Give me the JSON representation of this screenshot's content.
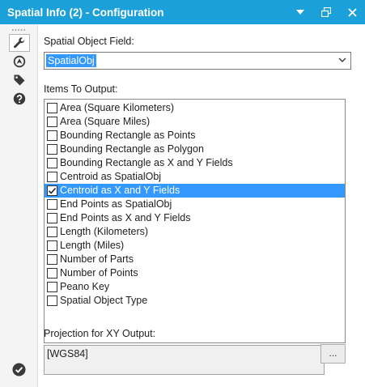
{
  "window": {
    "title": "Spatial Info (2) - Configuration",
    "buttons": [
      "chevron-down-icon",
      "restore-icon",
      "close-icon"
    ]
  },
  "toolbar": {
    "tools": [
      {
        "icon": "wrench-icon",
        "active": true
      },
      {
        "icon": "target-icon",
        "active": false
      },
      {
        "icon": "tag-icon",
        "active": false
      },
      {
        "icon": "help-icon",
        "active": false
      }
    ],
    "bottom_icon": "checkmark-circle-icon"
  },
  "config": {
    "spatial_field_label": "Spatial Object Field:",
    "spatial_field_value": "SpatialObj",
    "items_label": "Items To Output:",
    "items": [
      {
        "label": "Area (Square Kilometers)",
        "checked": false,
        "selected": false
      },
      {
        "label": "Area (Square Miles)",
        "checked": false,
        "selected": false
      },
      {
        "label": "Bounding Rectangle as Points",
        "checked": false,
        "selected": false
      },
      {
        "label": "Bounding Rectangle as Polygon",
        "checked": false,
        "selected": false
      },
      {
        "label": "Bounding Rectangle as X and Y Fields",
        "checked": false,
        "selected": false
      },
      {
        "label": "Centroid as SpatialObj",
        "checked": false,
        "selected": false
      },
      {
        "label": "Centroid as X and Y Fields",
        "checked": true,
        "selected": true
      },
      {
        "label": "End Points as SpatialObj",
        "checked": false,
        "selected": false
      },
      {
        "label": "End Points as X and Y Fields",
        "checked": false,
        "selected": false
      },
      {
        "label": "Length (Kilometers)",
        "checked": false,
        "selected": false
      },
      {
        "label": "Length (Miles)",
        "checked": false,
        "selected": false
      },
      {
        "label": "Number of Parts",
        "checked": false,
        "selected": false
      },
      {
        "label": "Number of Points",
        "checked": false,
        "selected": false
      },
      {
        "label": "Peano Key",
        "checked": false,
        "selected": false
      },
      {
        "label": "Spatial Object Type",
        "checked": false,
        "selected": false
      }
    ],
    "projection_label": "Projection for XY Output:",
    "projection_value": "[WGS84]",
    "projection_button": "..."
  },
  "colors": {
    "title_bar": "#1ca0d9",
    "selection": "#3399ff",
    "icon": "#3a3a3a"
  }
}
